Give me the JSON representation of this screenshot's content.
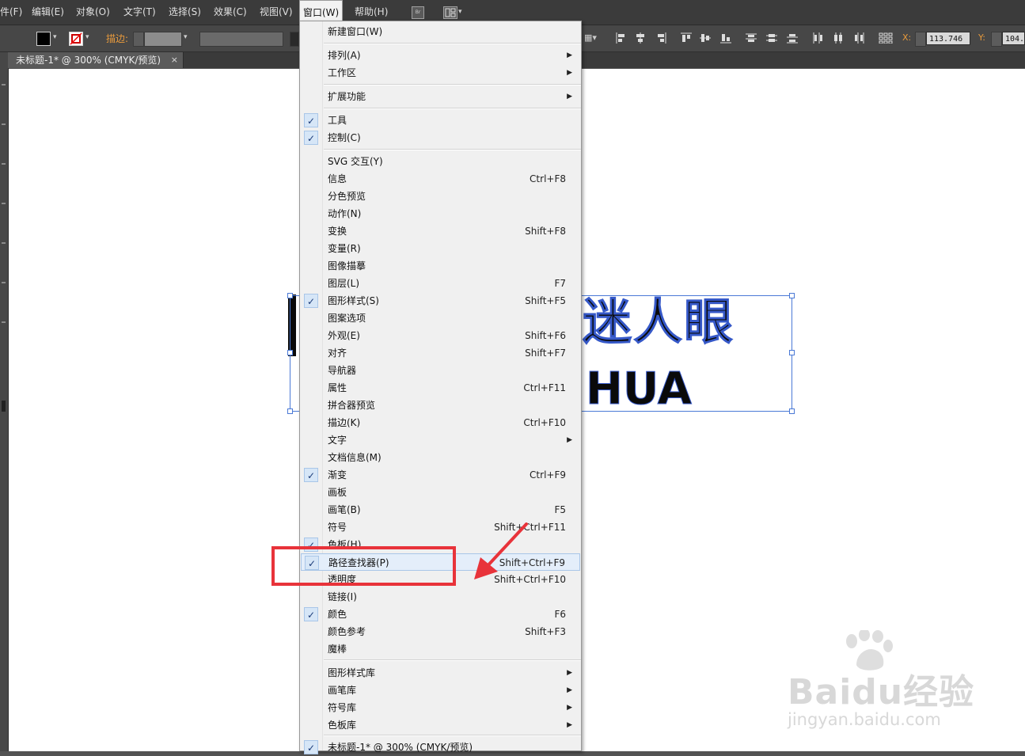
{
  "menubar": {
    "items": [
      "件(F)",
      "编辑(E)",
      "对象(O)",
      "文字(T)",
      "选择(S)",
      "效果(C)",
      "视图(V)",
      "窗口(W)",
      "帮助(H)"
    ],
    "active_index": 7,
    "br_label": "Br"
  },
  "controlbar": {
    "stroke_label": "描边:",
    "x_label": "X:",
    "x_value": "113.746",
    "y_label": "Y:",
    "y_value": "104."
  },
  "document_tab": {
    "title": "未标题-1* @ 300% (CMYK/预览)",
    "close": "×"
  },
  "artwork": {
    "line1": "迷人眼",
    "line2": "HUA"
  },
  "window_menu": {
    "items": [
      {
        "label": "新建窗口(W)"
      },
      {
        "label": "排列(A)",
        "submenu": true
      },
      {
        "label": "工作区",
        "submenu": true
      },
      {
        "label": "扩展功能",
        "submenu": true
      },
      {
        "label": "工具",
        "checked": true
      },
      {
        "label": "控制(C)",
        "checked": true
      },
      {
        "label": "SVG 交互(Y)"
      },
      {
        "label": "信息",
        "shortcut": "Ctrl+F8"
      },
      {
        "label": "分色预览"
      },
      {
        "label": "动作(N)"
      },
      {
        "label": "变换",
        "shortcut": "Shift+F8"
      },
      {
        "label": "变量(R)"
      },
      {
        "label": "图像描摹"
      },
      {
        "label": "图层(L)",
        "shortcut": "F7"
      },
      {
        "label": "图形样式(S)",
        "shortcut": "Shift+F5",
        "checked": true
      },
      {
        "label": "图案选项"
      },
      {
        "label": "外观(E)",
        "shortcut": "Shift+F6"
      },
      {
        "label": "对齐",
        "shortcut": "Shift+F7"
      },
      {
        "label": "导航器"
      },
      {
        "label": "属性",
        "shortcut": "Ctrl+F11"
      },
      {
        "label": "拼合器预览"
      },
      {
        "label": "描边(K)",
        "shortcut": "Ctrl+F10"
      },
      {
        "label": "文字",
        "submenu": true
      },
      {
        "label": "文档信息(M)"
      },
      {
        "label": "渐变",
        "shortcut": "Ctrl+F9",
        "checked": true
      },
      {
        "label": "画板"
      },
      {
        "label": "画笔(B)",
        "shortcut": "F5"
      },
      {
        "label": "符号",
        "shortcut": "Shift+Ctrl+F11"
      },
      {
        "label": "色板(H)",
        "checked": true
      },
      {
        "label": "路径查找器(P)",
        "shortcut": "Shift+Ctrl+F9",
        "checked": true,
        "highlighted": true
      },
      {
        "label": "透明度",
        "shortcut": "Shift+Ctrl+F10"
      },
      {
        "label": "链接(I)"
      },
      {
        "label": "颜色",
        "shortcut": "F6",
        "checked": true
      },
      {
        "label": "颜色参考",
        "shortcut": "Shift+F3"
      },
      {
        "label": "魔棒"
      },
      {
        "label": "图形样式库",
        "submenu": true
      },
      {
        "label": "画笔库",
        "submenu": true
      },
      {
        "label": "符号库",
        "submenu": true
      },
      {
        "label": "色板库",
        "submenu": true
      },
      {
        "label": "未标题-1* @ 300% (CMYK/预览)",
        "checked": true
      }
    ],
    "check_glyph": "✓",
    "submenu_glyph": "▶"
  },
  "watermark": {
    "logo": "Baidu经验",
    "url": "jingyan.baidu.com"
  },
  "colors": {
    "annotation_red": "#e8333a",
    "selection_blue": "#4a79d6",
    "stroke_label_orange": "#e89a3c"
  }
}
